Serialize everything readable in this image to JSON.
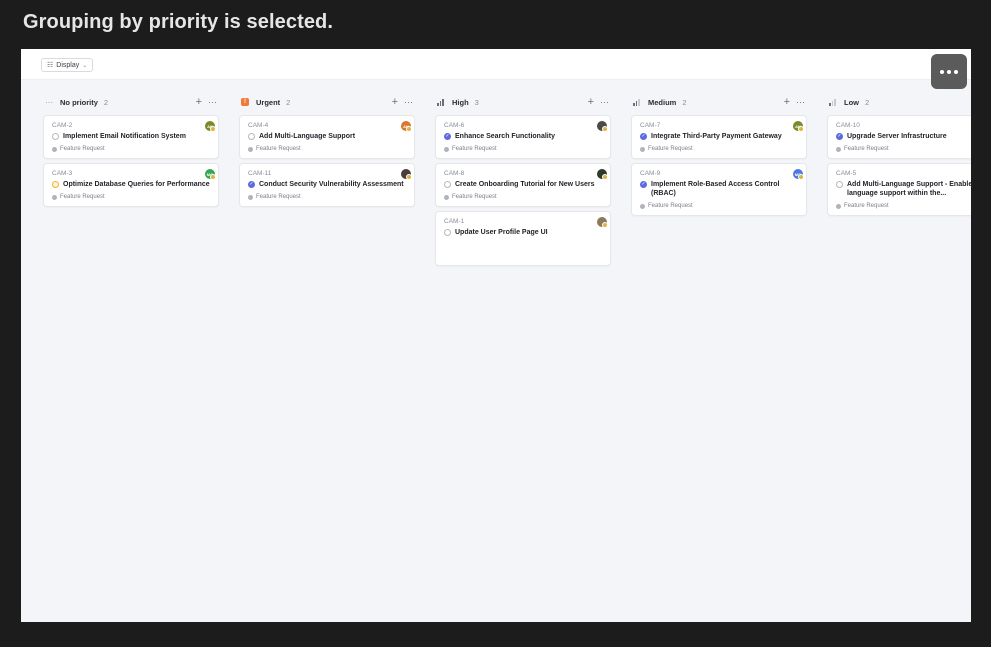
{
  "caption": "Grouping by priority is selected.",
  "toolbar": {
    "display_label": "Display"
  },
  "colors": {
    "urgent": "#f07a3a",
    "done": "#5b6ae0",
    "background": "#f4f5f8"
  },
  "columns": [
    {
      "title": "No priority",
      "count": "2",
      "icon": "no-priority-icon",
      "cards": [
        {
          "id": "CAM-2",
          "title": "Implement Email Notification System",
          "status": "todo",
          "label": "Feature Request",
          "avatar_color": "#7a8c2a",
          "avatar_text": "AK"
        },
        {
          "id": "CAM-3",
          "title": "Optimize Database Queries for Performance",
          "status": "prog",
          "label": "Feature Request",
          "avatar_color": "#34a853",
          "avatar_text": "MO"
        }
      ]
    },
    {
      "title": "Urgent",
      "count": "2",
      "icon": "urgent-icon",
      "cards": [
        {
          "id": "CAM-4",
          "title": "Add Multi-Language Support",
          "status": "todo",
          "label": "Feature Request",
          "avatar_color": "#d9772e",
          "avatar_text": "AK"
        },
        {
          "id": "CAM-11",
          "title": "Conduct Security Vulnerability Assessment",
          "status": "done",
          "label": "Feature Request",
          "avatar_color": "#4a3f3c",
          "avatar_text": ""
        }
      ]
    },
    {
      "title": "High",
      "count": "3",
      "icon": "high-priority-icon",
      "cards": [
        {
          "id": "CAM-6",
          "title": "Enhance Search Functionality",
          "status": "done",
          "label": "Feature Request",
          "avatar_color": "#4a4a4a",
          "avatar_text": ""
        },
        {
          "id": "CAM-8",
          "title": "Create Onboarding Tutorial for New Users",
          "status": "todo",
          "label": "Feature Request",
          "avatar_color": "#2f3b2a",
          "avatar_text": ""
        },
        {
          "id": "CAM-1",
          "title": "Update User Profile Page UI",
          "status": "todo",
          "label": "",
          "avatar_color": "#8a7a5a",
          "avatar_text": ""
        }
      ]
    },
    {
      "title": "Medium",
      "count": "2",
      "icon": "medium-priority-icon",
      "cards": [
        {
          "id": "CAM-7",
          "title": "Integrate Third-Party Payment Gateway",
          "status": "done",
          "label": "Feature Request",
          "avatar_color": "#7a8c2a",
          "avatar_text": "AK"
        },
        {
          "id": "CAM-9",
          "title": "Implement Role-Based Access Control (RBAC)",
          "status": "done",
          "label": "Feature Request",
          "avatar_color": "#4b7be0",
          "avatar_text": "MO"
        }
      ]
    },
    {
      "title": "Low",
      "count": "2",
      "icon": "low-priority-icon",
      "cards": [
        {
          "id": "CAM-10",
          "title": "Upgrade Server Infrastructure",
          "status": "done",
          "label": "Feature Request",
          "avatar_color": "",
          "avatar_text": ""
        },
        {
          "id": "CAM-5",
          "title": "Add Multi-Language Support - Enable multi-language support within the...",
          "status": "todo",
          "label": "Feature Request",
          "avatar_color": "",
          "avatar_text": ""
        }
      ]
    }
  ]
}
